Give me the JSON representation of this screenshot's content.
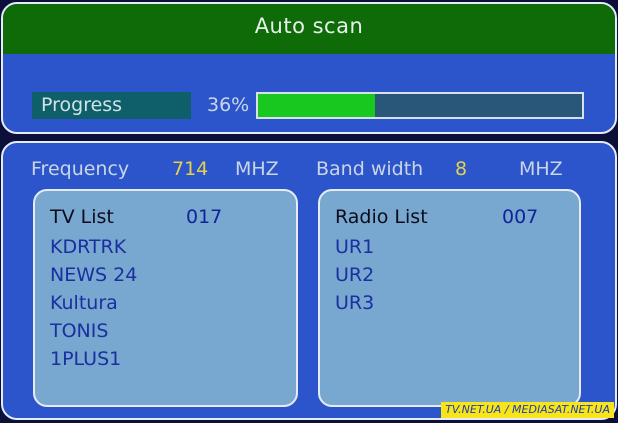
{
  "header": {
    "title": "Auto scan"
  },
  "progress": {
    "label": "Progress",
    "percent_text": "36%",
    "fraction": 0.36
  },
  "info": {
    "frequency_label": "Frequency",
    "frequency_value": "714",
    "frequency_unit": "MHZ",
    "bandwidth_label": "Band width",
    "bandwidth_value": "8",
    "bandwidth_unit": "MHZ"
  },
  "tv_list": {
    "title": "TV List",
    "count": "017",
    "items": [
      "KDRTRK",
      "NEWS 24",
      "Kultura",
      "TONIS",
      "1PLUS1"
    ]
  },
  "radio_list": {
    "title": "Radio List",
    "count": "007",
    "items": [
      "UR1",
      "UR2",
      "UR3"
    ]
  },
  "watermark": {
    "text": "TV.NET.UA / MEDIASAT.NET.UA"
  },
  "colors": {
    "title_bar": "#0e6b07",
    "panel": "#2c55cc",
    "list_bg": "#78a8d0",
    "progress_fill": "#18c81e",
    "progress_track": "#28577a",
    "value_yellow": "#e5d24a"
  }
}
